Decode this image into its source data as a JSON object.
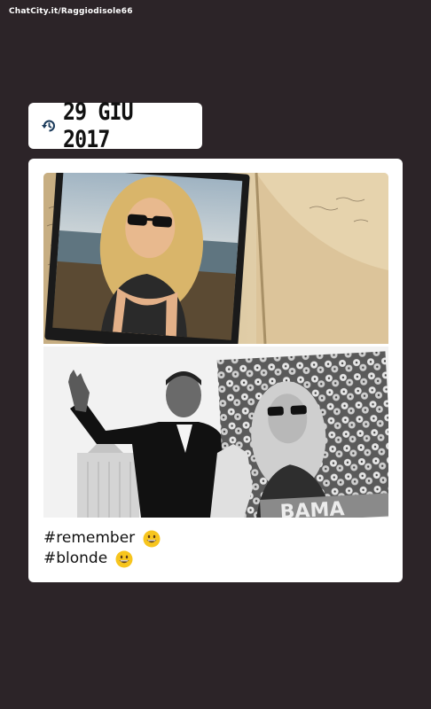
{
  "watermark": "ChatCity.it/Raggiodisole66",
  "date_chip": {
    "icon": "history-icon",
    "text": "29 GIU 2017"
  },
  "post": {
    "images": [
      {
        "name": "photo-collage-top",
        "description_icon": "photo"
      },
      {
        "name": "photo-collage-bottom",
        "description_icon": "photo"
      }
    ],
    "hashtags": [
      {
        "text": "#remember",
        "emoji": "grinning-face-icon"
      },
      {
        "text": "#blonde",
        "emoji": "grinning-face-icon"
      }
    ],
    "bottom_image_text": "BAMA"
  },
  "colors": {
    "background": "#2c2428",
    "card": "#ffffff",
    "emoji_face": "#f7c51e"
  }
}
